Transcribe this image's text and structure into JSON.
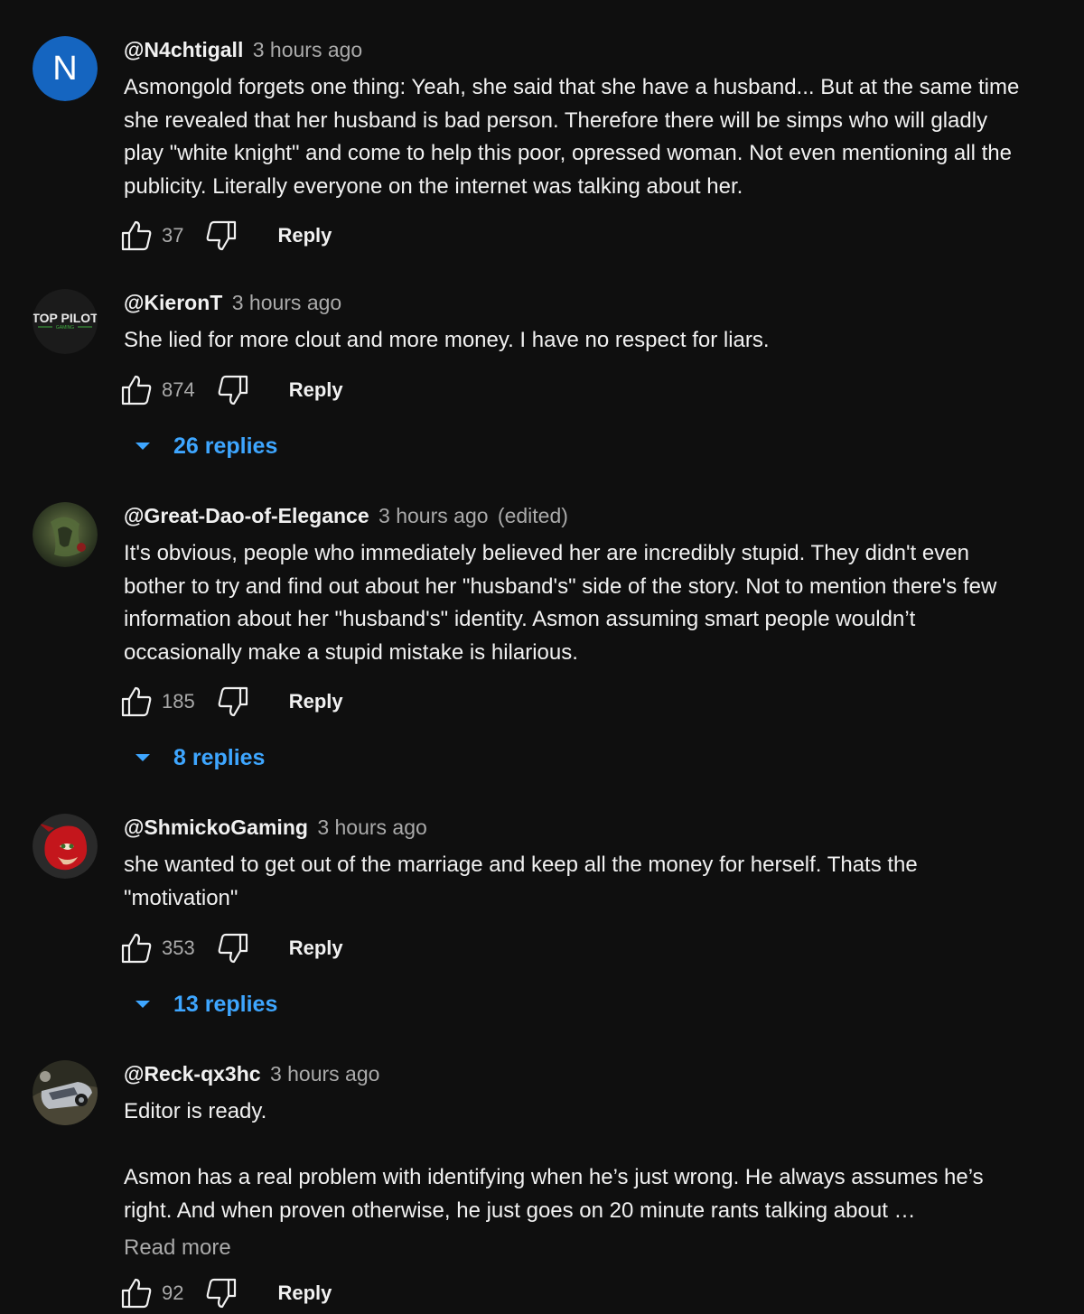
{
  "comments": [
    {
      "author": "@N4chtigall",
      "time": "3 hours ago",
      "edited": "",
      "avatar_letter": "N",
      "paragraphs": [
        "Asmongold forgets one thing: Yeah, she said that she have a husband... But at the same time she revealed that her husband is bad person. Therefore there will be simps who will gladly play \"white knight\" and come to help this poor, opressed woman. Not even mentioning all the publicity. Literally everyone on the internet was talking about her."
      ],
      "likes": "37",
      "reply_label": "Reply",
      "replies_label": ""
    },
    {
      "author": "@KieronT",
      "time": "3 hours ago",
      "edited": "",
      "avatar_text": "TOP PILOT",
      "avatar_subtext": "GAMING",
      "paragraphs": [
        "She lied for more clout and more money. I have no respect for liars."
      ],
      "likes": "874",
      "reply_label": "Reply",
      "replies_label": "26 replies"
    },
    {
      "author": "@Great-Dao-of-Elegance",
      "time": "3 hours ago",
      "edited": "(edited)",
      "paragraphs": [
        "It's obvious, people who immediately believed her are incredibly stupid. They didn't even bother to try and find out about her \"husband's\" side of the story. Not to mention there's few information about her \"husband's\" identity. Asmon assuming smart people wouldn’t occasionally make a stupid mistake is hilarious."
      ],
      "likes": "185",
      "reply_label": "Reply",
      "replies_label": "8 replies"
    },
    {
      "author": "@ShmickoGaming",
      "time": "3 hours ago",
      "edited": "",
      "paragraphs": [
        "she wanted to get out of the marriage and keep all the money for herself. Thats the \"motivation\""
      ],
      "likes": "353",
      "reply_label": "Reply",
      "replies_label": "13 replies"
    },
    {
      "author": "@Reck-qx3hc",
      "time": "3 hours ago",
      "edited": "",
      "paragraphs": [
        "Editor is ready.",
        "Asmon has a real problem with identifying when he’s just wrong. He always assumes he’s right. And when proven otherwise, he just goes on 20 minute rants talking about …"
      ],
      "read_more": "Read more",
      "likes": "92",
      "reply_label": "Reply",
      "replies_label": ""
    }
  ],
  "colors": {
    "background": "#0f0f0f",
    "text": "#f1f1f1",
    "secondary": "#aaaaaa",
    "link": "#3ea6ff",
    "avatar_n": "#1565c0"
  }
}
